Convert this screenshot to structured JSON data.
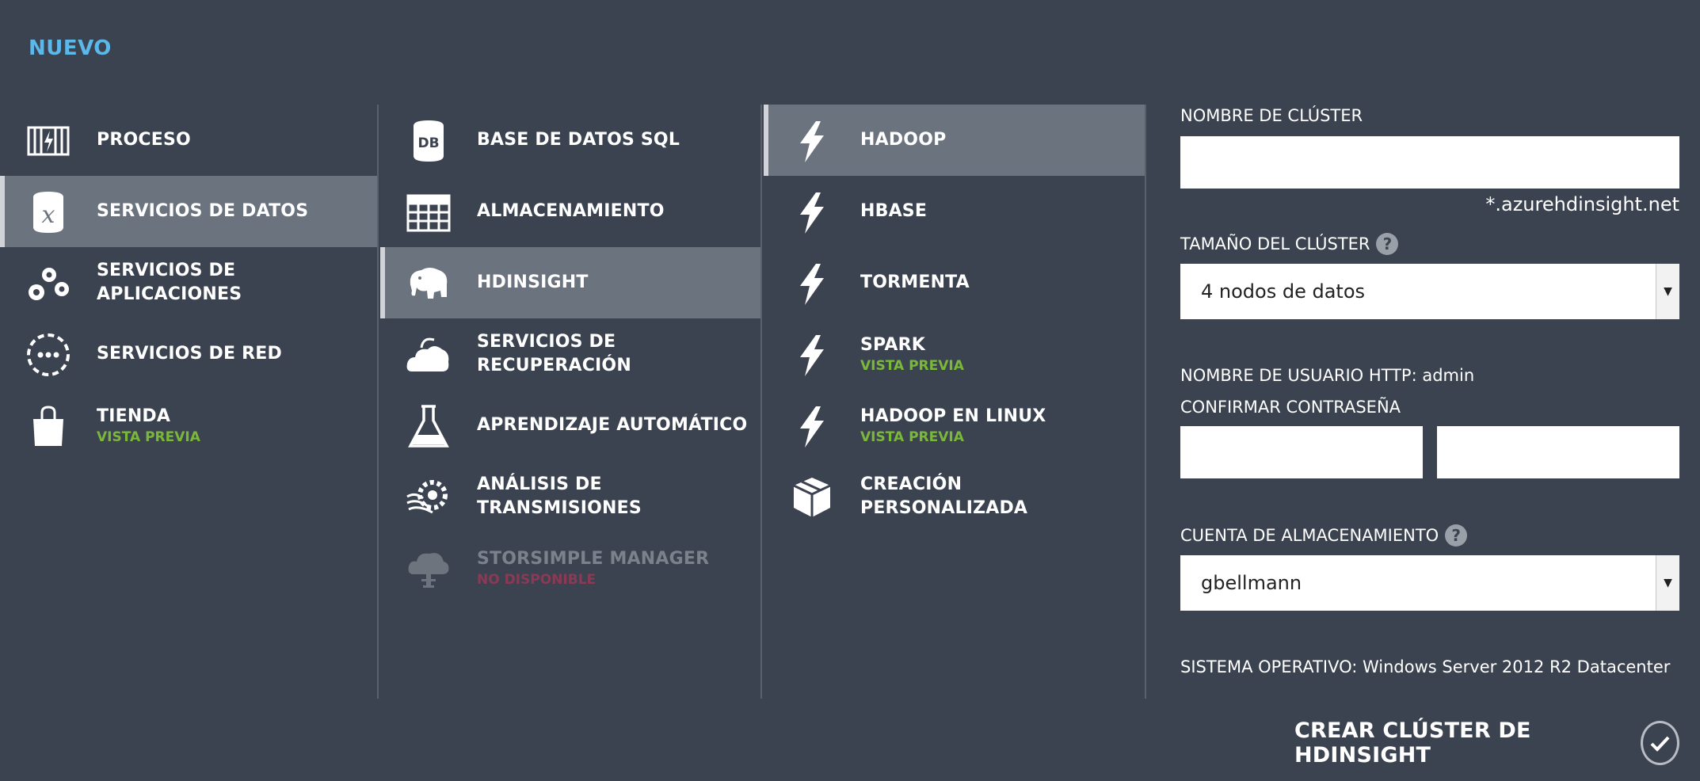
{
  "header": {
    "title": "NUEVO"
  },
  "categories": [
    {
      "label": "PROCESO",
      "icon": "compute-icon"
    },
    {
      "label": "SERVICIOS DE DATOS",
      "icon": "data-services-icon",
      "selected": true
    },
    {
      "label": "SERVICIOS DE APLICACIONES",
      "icon": "gears-icon"
    },
    {
      "label": "SERVICIOS DE RED",
      "icon": "network-icon"
    },
    {
      "label": "TIENDA",
      "sub": "VISTA PREVIA",
      "icon": "shopping-bag-icon"
    }
  ],
  "data_services": [
    {
      "label": "BASE DE DATOS SQL",
      "icon": "database-icon"
    },
    {
      "label": "ALMACENAMIENTO",
      "icon": "table-grid-icon"
    },
    {
      "label": "HDINSIGHT",
      "icon": "elephant-icon",
      "selected": true
    },
    {
      "label": "SERVICIOS DE RECUPERACIÓN",
      "icon": "cloud-recovery-icon"
    },
    {
      "label": "APRENDIZAJE AUTOMÁTICO",
      "icon": "flask-icon"
    },
    {
      "label": "ANÁLISIS DE TRANSMISIONES",
      "icon": "stream-gear-icon"
    },
    {
      "label": "STORSIMPLE MANAGER",
      "sub": "NO DISPONIBLE",
      "icon": "storsimple-icon",
      "disabled": true
    }
  ],
  "cluster_types": [
    {
      "label": "HADOOP",
      "icon": "lightning-icon",
      "selected": true
    },
    {
      "label": "HBASE",
      "icon": "lightning-icon"
    },
    {
      "label": "TORMENTA",
      "icon": "lightning-icon"
    },
    {
      "label": "SPARK",
      "sub": "VISTA PREVIA",
      "icon": "lightning-icon"
    },
    {
      "label": "HADOOP EN LINUX",
      "sub": "VISTA PREVIA",
      "icon": "lightning-icon"
    },
    {
      "label": "CREACIÓN",
      "label2": "PERSONALIZADA",
      "icon": "package-box-icon"
    }
  ],
  "form": {
    "cluster_name_label": "NOMBRE DE CLÚSTER",
    "cluster_name_value": "",
    "cluster_name_suffix": "*.azurehdinsight.net",
    "cluster_size_label": "TAMAÑO DEL CLÚSTER",
    "cluster_size_value": "4 nodos de datos",
    "http_user_label": "NOMBRE DE USUARIO HTTP: admin",
    "confirm_password_label": "CONFIRMAR CONTRASEÑA",
    "password_value": "",
    "confirm_value": "",
    "storage_account_label": "CUENTA DE ALMACENAMIENTO",
    "storage_account_value": "gbellmann",
    "os_label": "SISTEMA OPERATIVO: Windows Server 2012 R2 Datacenter",
    "help_glyph": "?"
  },
  "footer": {
    "create_label": "CREAR CLÚSTER DE HDINSIGHT"
  }
}
